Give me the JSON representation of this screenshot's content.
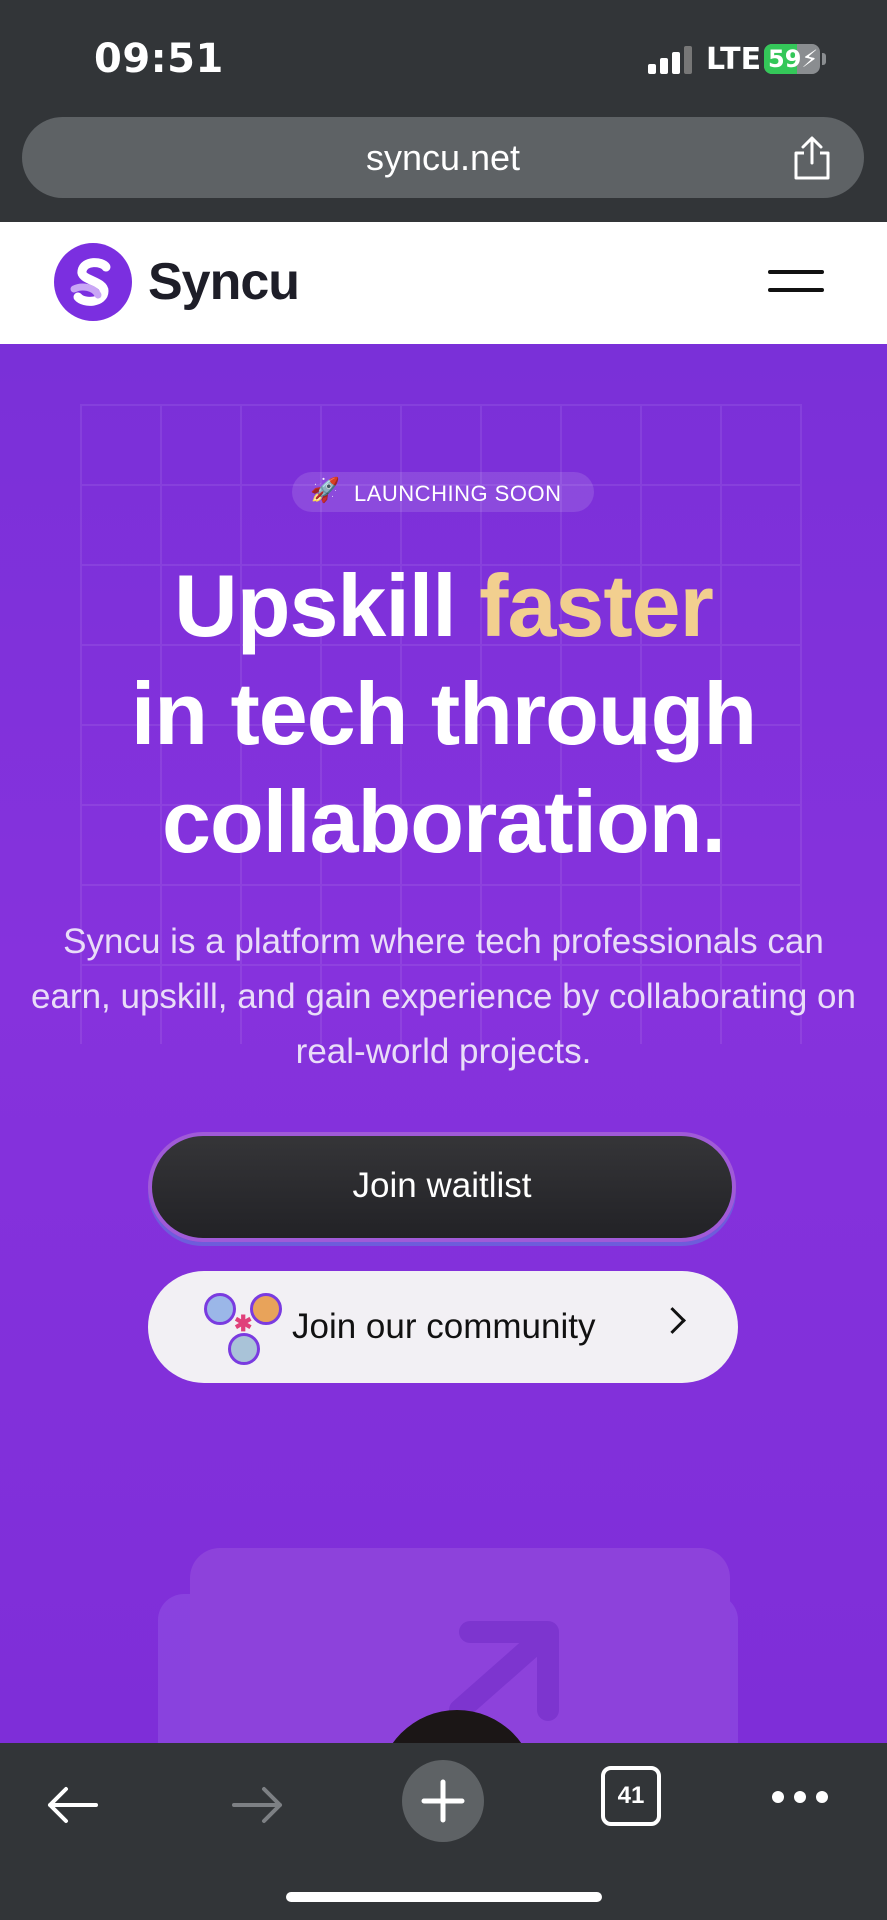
{
  "status_bar": {
    "time": "09:51",
    "network": "LTE",
    "battery": "59",
    "battery_level": 0.59,
    "icons": [
      "signal-icon",
      "battery-charging-icon"
    ]
  },
  "browser": {
    "url": "syncu.net",
    "icons": [
      "share-icon"
    ]
  },
  "site_header": {
    "logo_text": "Syncu",
    "icons": [
      "syncu-logo-icon",
      "menu-icon"
    ]
  },
  "hero": {
    "badge": "LAUNCHING SOON",
    "badge_icon": "🚀",
    "headline_part1": "Upskill ",
    "headline_accent": "faster",
    "headline_line2": "in tech through",
    "headline_line3": "collaboration.",
    "subtext": "Syncu is a platform where tech professionals can earn, upskill, and gain experience by collaborating on real-world projects.",
    "primary_button": "Join waitlist",
    "secondary_button": "Join our community",
    "accent_color": "#f2cf8f",
    "brand_color": "#7b2fe0"
  },
  "toolbar": {
    "tabs_count": "41",
    "icons": [
      "back-arrow-icon",
      "forward-arrow-icon",
      "new-tab-plus-icon",
      "tabs-icon",
      "more-icon"
    ]
  }
}
